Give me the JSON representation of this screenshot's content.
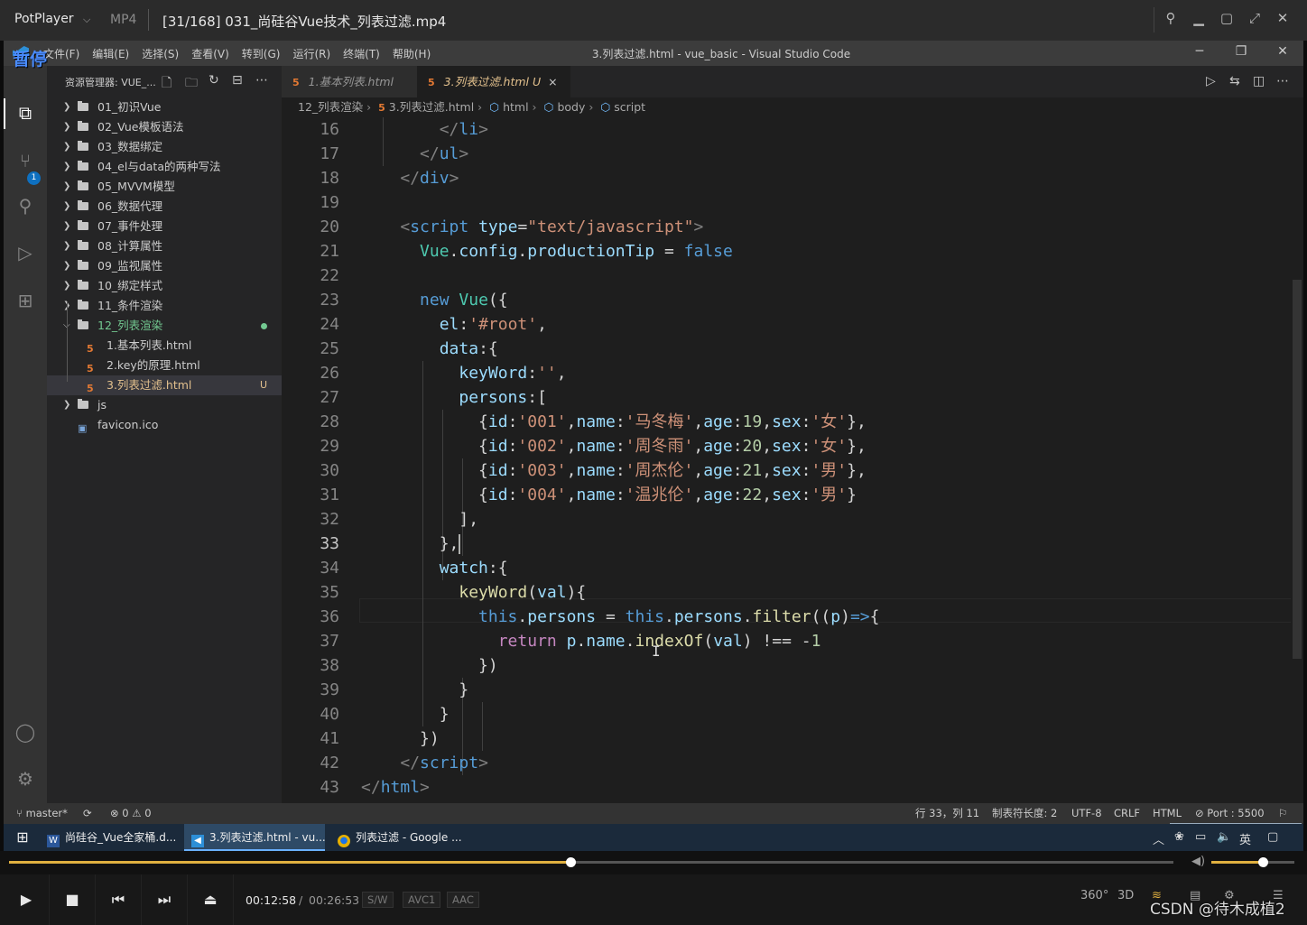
{
  "player": {
    "brand": "PotPlayer",
    "format": "MP4",
    "file_title": "[31/168] 031_尚硅谷Vue技术_列表过滤.mp4",
    "pause_badge": "暂停",
    "time_current": "00:12:58",
    "time_sep": "/",
    "time_total": "00:26:53",
    "chips": [
      "S/W",
      "AVC1",
      "AAC"
    ],
    "progress": 0.482,
    "volume": 0.62,
    "right_labels": [
      "360°",
      "3D"
    ],
    "watermark": "CSDN @待木成植2"
  },
  "vscode": {
    "title": "3.列表过滤.html - vue_basic - Visual Studio Code",
    "menu": [
      "文件(F)",
      "编辑(E)",
      "选择(S)",
      "查看(V)",
      "转到(G)",
      "运行(R)",
      "终端(T)",
      "帮助(H)"
    ],
    "explorer_title": "资源管理器: VUE_...",
    "tree": [
      {
        "label": "01_初识Vue",
        "type": "folder"
      },
      {
        "label": "02_Vue模板语法",
        "type": "folder"
      },
      {
        "label": "03_数据绑定",
        "type": "folder"
      },
      {
        "label": "04_el与data的两种写法",
        "type": "folder"
      },
      {
        "label": "05_MVVM模型",
        "type": "folder"
      },
      {
        "label": "06_数据代理",
        "type": "folder"
      },
      {
        "label": "07_事件处理",
        "type": "folder"
      },
      {
        "label": "08_计算属性",
        "type": "folder"
      },
      {
        "label": "09_监视属性",
        "type": "folder"
      },
      {
        "label": "10_绑定样式",
        "type": "folder"
      },
      {
        "label": "11_条件渲染",
        "type": "folder"
      },
      {
        "label": "12_列表渲染",
        "type": "folder-open"
      },
      {
        "label": "1.基本列表.html",
        "type": "html"
      },
      {
        "label": "2.key的原理.html",
        "type": "html"
      },
      {
        "label": "3.列表过滤.html",
        "type": "html-selected",
        "badge": "U"
      },
      {
        "label": "js",
        "type": "folder"
      },
      {
        "label": "favicon.ico",
        "type": "ico"
      }
    ],
    "tabs": [
      {
        "label": "1.基本列表.html"
      },
      {
        "label": "3.列表过滤.html",
        "badge": "U",
        "close": "×"
      }
    ],
    "scm_badge": "1",
    "breadcrumbs": [
      "12_列表渲染",
      "3.列表过滤.html",
      "html",
      "body",
      "script"
    ],
    "line_numbers": [
      "16",
      "17",
      "18",
      "19",
      "20",
      "21",
      "22",
      "23",
      "24",
      "25",
      "26",
      "27",
      "28",
      "29",
      "30",
      "31",
      "32",
      "33",
      "34",
      "35",
      "36",
      "37",
      "38",
      "39",
      "40",
      "41",
      "42",
      "43"
    ],
    "current_line": "33",
    "status": {
      "branch": "master*",
      "problems": "⊗ 0 ⚠ 0",
      "position": "行 33，列 11",
      "tab_size": "制表符长度: 2",
      "encoding": "UTF-8",
      "eol": "CRLF",
      "language": "HTML",
      "port": "⊘ Port : 5500"
    },
    "ime": "英"
  },
  "taskbar": {
    "items": [
      "尚硅谷_Vue全家桶.d...",
      "3.列表过滤.html - vu...",
      "列表过滤 - Google ..."
    ],
    "tray_lang": "英"
  },
  "colors": {
    "accent": "#007acc",
    "pause": "#4a8cff",
    "progress": "#e0b040",
    "git_added": "#73c991",
    "git_untracked": "#e2c08d"
  }
}
